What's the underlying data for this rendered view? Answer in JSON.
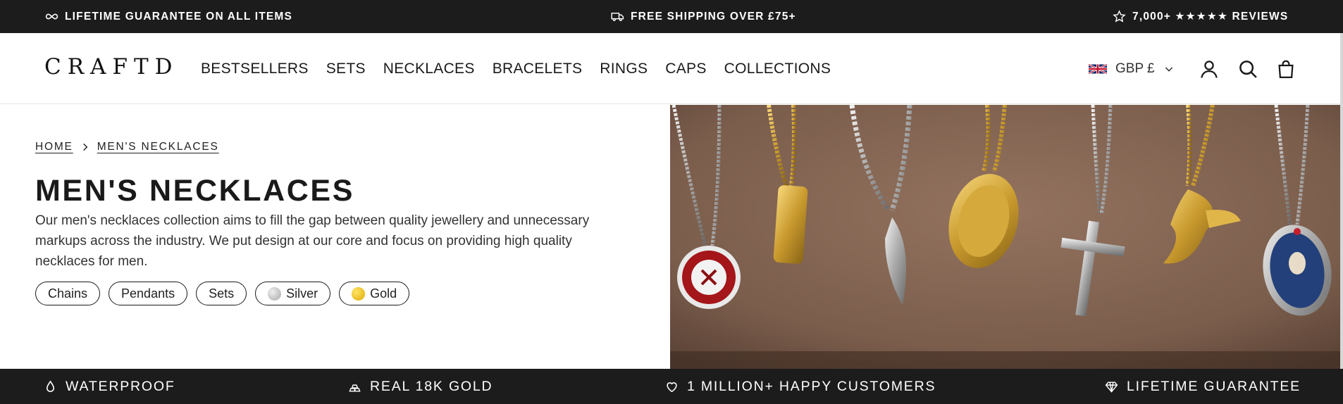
{
  "announcement": {
    "items": [
      {
        "icon": "infinity-icon",
        "text": "LIFETIME GUARANTEE ON ALL ITEMS"
      },
      {
        "icon": "truck-icon",
        "text": "FREE SHIPPING OVER £75+"
      },
      {
        "icon": "star-icon",
        "text": "7,000+ ★★★★★ REVIEWS"
      }
    ]
  },
  "header": {
    "logo": "CRAFTD",
    "nav": [
      "BESTSELLERS",
      "SETS",
      "NECKLACES",
      "BRACELETS",
      "RINGS",
      "CAPS",
      "COLLECTIONS"
    ],
    "currency": "GBP £",
    "icons": [
      "account-icon",
      "search-icon",
      "bag-icon"
    ]
  },
  "breadcrumb": {
    "home": "HOME",
    "current": "MEN'S NECKLACES"
  },
  "page": {
    "title": "MEN'S NECKLACES",
    "description": "Our men's necklaces collection aims to fill the gap between quality jewellery and unnecessary markups across the industry. We put design at our core and focus on providing high quality necklaces for men."
  },
  "filters": [
    {
      "label": "Chains"
    },
    {
      "label": "Pendants"
    },
    {
      "label": "Sets"
    },
    {
      "label": "Silver",
      "swatch": "#c9c9c9"
    },
    {
      "label": "Gold",
      "swatch": "#f2c41b"
    }
  ],
  "features": [
    {
      "icon": "water-drop-icon",
      "text": "WATERPROOF"
    },
    {
      "icon": "gold-bars-icon",
      "text": "REAL 18K GOLD"
    },
    {
      "icon": "heart-icon",
      "text": "1 MILLION+ HAPPY CUSTOMERS"
    },
    {
      "icon": "diamond-icon",
      "text": "LIFETIME GUARANTEE"
    }
  ],
  "colors": {
    "bar_background": "#1c1c1c",
    "text_dark": "#1a1a1a",
    "backdrop": "#8a6a58"
  }
}
